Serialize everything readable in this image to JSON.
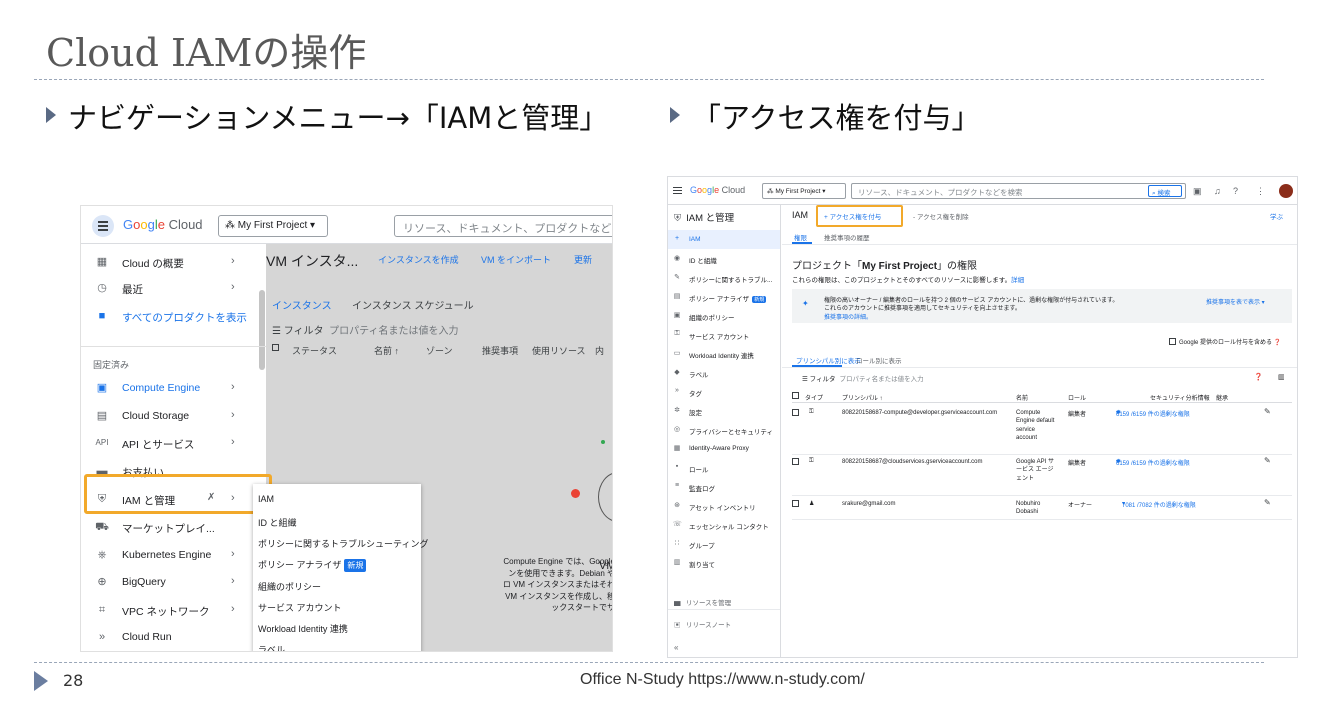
{
  "slide": {
    "title": "Cloud IAMの操作",
    "bullet_left": "ナビゲーションメニュー→「IAMと管理」",
    "bullet_right": "「アクセス権を付与」",
    "page_number": "28",
    "footer": "Office N-Study https://www.n-study.com/"
  },
  "left_shot": {
    "brand": "Google Cloud",
    "project": "My First Project",
    "search_placeholder": "リソース、ドキュメント、プロダクトなどを検索",
    "menu_top": [
      {
        "icon": "dashboard-icon",
        "glyph": "▦",
        "label": "Cloud の概要",
        "arrow": "›"
      },
      {
        "icon": "history-icon",
        "glyph": "◷",
        "label": "最近",
        "arrow": "›"
      }
    ],
    "all_products": "すべてのプロダクトを表示",
    "pinned_label": "固定済み",
    "menu_pinned": [
      {
        "icon": "chip-icon",
        "glyph": "▣",
        "label": "Compute Engine"
      },
      {
        "icon": "storage-icon",
        "glyph": "▤",
        "label": "Cloud Storage"
      },
      {
        "icon": "api-icon",
        "glyph": "API",
        "label": "API とサービス"
      },
      {
        "icon": "billing-icon",
        "glyph": "▬",
        "label": "お支払い"
      },
      {
        "icon": "shield-icon",
        "glyph": "⛨",
        "label": "IAM と管理"
      },
      {
        "icon": "cart-icon",
        "glyph": "⛟",
        "label": "マーケットプレイ..."
      },
      {
        "icon": "kubernetes-icon",
        "glyph": "⎈",
        "label": "Kubernetes Engine"
      },
      {
        "icon": "bigquery-icon",
        "glyph": "⊕",
        "label": "BigQuery"
      },
      {
        "icon": "network-icon",
        "glyph": "⌗",
        "label": "VPC ネットワーク"
      },
      {
        "icon": "cloudrun-icon",
        "glyph": "»",
        "label": "Cloud Run"
      }
    ],
    "submenu": [
      "IAM",
      "ID と組織",
      "ポリシーに関するトラブルシューティング",
      "ポリシー アナライザ",
      "組織のポリシー",
      "サービス アカウント",
      "Workload Identity 連携",
      "ラベル"
    ],
    "submenu_badge": "新規",
    "bg_title": "VM インスタ...",
    "bg_actions": [
      "インスタンスを作成",
      "VM をインポート",
      "更新"
    ],
    "bg_tabs": [
      "インスタンス",
      "インスタンス スケジュール"
    ],
    "bg_filter": "フィルタ",
    "bg_filter_placeholder": "プロパティ名または値を入力",
    "bg_cols": [
      "ステータス",
      "名前 ↑",
      "ゾーン",
      "推奨事項",
      "使用リソース",
      "内"
    ],
    "bg_vm_title": "VM",
    "bg_vm_lines": [
      "Compute Engine では、Google",
      "ンを使用できます。Debian や",
      "ロ VM インスタンスまたはそれ",
      "VM インスタンスを作成し、移",
      "ックスタートでサ"
    ]
  },
  "right_shot": {
    "brand": "Google Cloud",
    "project": "My First Project",
    "search_placeholder": "リソース、ドキュメント、プロダクトなどを検索",
    "search_button": "検索",
    "side_title": "IAM と管理",
    "side_items": [
      {
        "icon": "person-add-icon",
        "glyph": "+",
        "label": "IAM"
      },
      {
        "icon": "id-icon",
        "glyph": "◉",
        "label": "ID と組織"
      },
      {
        "icon": "wrench-icon",
        "glyph": "✎",
        "label": "ポリシーに関するトラブル..."
      },
      {
        "icon": "analyzer-icon",
        "glyph": "▤",
        "label": "ポリシー アナライザ"
      },
      {
        "icon": "policy-icon",
        "glyph": "▣",
        "label": "組織のポリシー"
      },
      {
        "icon": "service-account-icon",
        "glyph": "⚿",
        "label": "サービス アカウント"
      },
      {
        "icon": "workload-icon",
        "glyph": "▭",
        "label": "Workload Identity 連携"
      },
      {
        "icon": "label-icon",
        "glyph": "◆",
        "label": "ラベル"
      },
      {
        "icon": "tag-icon",
        "glyph": "»",
        "label": "タグ"
      },
      {
        "icon": "settings-icon",
        "glyph": "✲",
        "label": "設定"
      },
      {
        "icon": "privacy-icon",
        "glyph": "◎",
        "label": "プライバシーとセキュリティ"
      },
      {
        "icon": "proxy-icon",
        "glyph": "▦",
        "label": "Identity-Aware Proxy"
      },
      {
        "icon": "role-icon",
        "glyph": "▪",
        "label": "ロール"
      },
      {
        "icon": "audit-icon",
        "glyph": "≡",
        "label": "監査ログ"
      },
      {
        "icon": "asset-icon",
        "glyph": "⊛",
        "label": "アセット インベントリ"
      },
      {
        "icon": "contact-icon",
        "glyph": "☏",
        "label": "エッセンシャル コンタクト"
      },
      {
        "icon": "group-icon",
        "glyph": "∷",
        "label": "グループ"
      },
      {
        "icon": "quota-icon",
        "glyph": "▥",
        "label": "割り当て"
      }
    ],
    "side_bottom": [
      "リソースを管理",
      "リリースノート"
    ],
    "page_label": "IAM",
    "grant_access": "アクセス権を付与",
    "remove_access": "アクセス権を削除",
    "learn": "学ぶ",
    "tabs": [
      "権限",
      "推奨事項の履歴"
    ],
    "heading_prefix": "プロジェクト「",
    "heading_project": "My First Project",
    "heading_suffix": "」の権限",
    "description": "これらの権限は、このプロジェクトとそのすべてのリソースに影響します。",
    "description_link": "詳細",
    "banner_lines": [
      "権限の高いオーナー / 編集者のロールを持つ 2 個のサービス アカウントに、過剰な権限が付与されています。",
      "これらのアカウントに推奨事項を適用してセキュリティを向上させます。"
    ],
    "banner_link": "推奨事項の詳細。",
    "banner_show": "推奨事項を表で表示",
    "google_roles": "Google 提供のロール付与を含める",
    "view_tabs": [
      "プリンシパル別に表示",
      "ロール別に表示"
    ],
    "filter": "フィルタ",
    "filter_placeholder": "プロパティ名または値を入力",
    "table_headers": [
      "タイプ",
      "プリンシパル ↑",
      "名前",
      "ロール",
      "セキュリティ分析情報",
      "継承"
    ],
    "rows": [
      {
        "principal": "808220158687-compute@developer.gserviceaccount.com",
        "name": "Compute Engine default service account",
        "role": "編集者",
        "security": "6159 /6159 件の過剰な権限"
      },
      {
        "principal": "808220158687@cloudservices.gserviceaccount.com",
        "name": "Google API サービス エージェント",
        "role": "編集者",
        "security": "6159 /6159 件の過剰な権限"
      },
      {
        "principal": "srakure@gmail.com",
        "name": "Nobuhiro Dobashi",
        "role": "オーナー",
        "security": "7081 /7082 件の過剰な権限"
      }
    ]
  },
  "colors": {
    "accent": "#1a73e8",
    "highlight": "#f2a92a",
    "title": "#595959"
  }
}
